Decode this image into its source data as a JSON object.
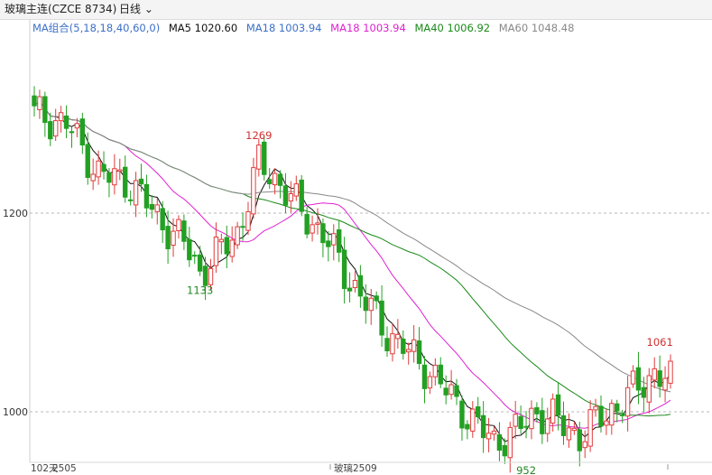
{
  "header": {
    "title": "玻璃主连(CZCE 8734)",
    "period": "日线"
  },
  "legend": [
    {
      "text": "MA组合(5,18,18,40,60,0)",
      "color": "#3b6fc8"
    },
    {
      "text": "MA5 1020.60",
      "color": "#111111"
    },
    {
      "text": "MA18 1003.94",
      "color": "#3b6fc8"
    },
    {
      "text": "MA18 1003.94",
      "color": "#e020d0"
    },
    {
      "text": "MA40 1006.92",
      "color": "#1a8a1a"
    },
    {
      "text": "MA60 1048.48",
      "color": "#888888"
    }
  ],
  "chart_data": {
    "type": "candlestick",
    "ylim": [
      940,
      1330
    ],
    "y_ticks": [
      1000,
      1200
    ],
    "x_labels": [
      "102天",
      "2505",
      "玻璃2509"
    ],
    "annotations": [
      {
        "label": "1269",
        "value": 1269,
        "index": 42,
        "color": "#d03030",
        "pos": "above"
      },
      {
        "label": "1133",
        "value": 1133,
        "index": 31,
        "color": "#228822",
        "pos": "below"
      },
      {
        "label": "952",
        "value": 952,
        "index": 92,
        "color": "#228822",
        "pos": "below"
      },
      {
        "label": "1061",
        "value": 1061,
        "index": 117,
        "color": "#d03030",
        "pos": "above"
      }
    ],
    "key_closes": [
      1300,
      1290,
      1240,
      1230,
      1190,
      1170,
      1140,
      1180,
      1250,
      1230,
      1200,
      1180,
      1140,
      1110,
      1080,
      1060,
      1040,
      1015,
      990,
      970,
      980,
      1000,
      990,
      975,
      995,
      1010,
      1040,
      1030
    ],
    "key_index": [
      0,
      6,
      12,
      18,
      24,
      28,
      31,
      38,
      42,
      46,
      50,
      54,
      58,
      62,
      66,
      70,
      74,
      78,
      82,
      86,
      90,
      94,
      98,
      102,
      106,
      110,
      116,
      119
    ],
    "ma_lines": [
      {
        "name": "MA5",
        "color": "#111111"
      },
      {
        "name": "MA18",
        "color": "#e020d0"
      },
      {
        "name": "MA40",
        "color": "#1a8a1a"
      },
      {
        "name": "MA60",
        "color": "#888888"
      }
    ]
  }
}
